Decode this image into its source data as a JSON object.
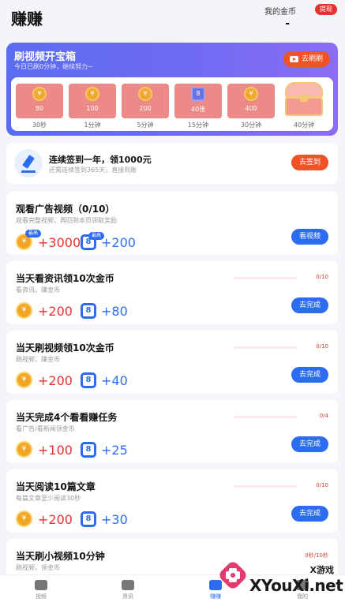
{
  "header": {
    "title": "赚赚",
    "gold_label": "我的金币",
    "withdraw_label": "提现",
    "gold_value": "-"
  },
  "treasure": {
    "title": "刷视频开宝箱",
    "subtitle": "今日已刷0分钟，继续努力~",
    "button_label": "去刷刷",
    "slots": [
      {
        "value": "80",
        "time": "30秒",
        "icon": "coin-icon"
      },
      {
        "value": "100",
        "time": "1分钟",
        "icon": "coin-icon"
      },
      {
        "value": "200",
        "time": "5分钟",
        "icon": "coin-icon"
      },
      {
        "value": "40张",
        "time": "15分钟",
        "icon": "coupon-icon"
      },
      {
        "value": "400",
        "time": "30分钟",
        "icon": "coin-icon"
      },
      {
        "value": "",
        "time": "40分钟",
        "icon": "treasure-chest-icon"
      }
    ]
  },
  "sign": {
    "title": "连续签到一年，领1000元",
    "subtitle": "还需连续签到365天，直接到账",
    "button_label": "去签到"
  },
  "tasks": [
    {
      "title": "观看广告视频（0/10）",
      "subtitle": "观看完整视频，再回到本页领取奖励",
      "coin_reward": "+3000",
      "rmb_reward": "+200",
      "coin_tag": "最高",
      "rmb_tag": "最高",
      "button_label": "看视频",
      "progress": ""
    },
    {
      "title": "当天看资讯领10次金币",
      "subtitle": "看资讯，赚金币",
      "coin_reward": "+200",
      "rmb_reward": "+80",
      "button_label": "去完成",
      "progress": "0/10"
    },
    {
      "title": "当天刷视频领10次金币",
      "subtitle": "刷视频，赚金币",
      "coin_reward": "+200",
      "rmb_reward": "+40",
      "button_label": "去完成",
      "progress": "0/10"
    },
    {
      "title": "当天完成4个看看赚任务",
      "subtitle": "看广告/看新闻领金币",
      "coin_reward": "+100",
      "rmb_reward": "+25",
      "button_label": "去完成",
      "progress": "0/4"
    },
    {
      "title": "当天阅读10篇文章",
      "subtitle": "每篇文章至少阅读30秒",
      "coin_reward": "+200",
      "rmb_reward": "+30",
      "button_label": "去完成",
      "progress": "0/10"
    },
    {
      "title": "当天刷小视频10分钟",
      "subtitle": "刷视频，领金币",
      "progress": "0秒/10秒"
    }
  ],
  "bottom_nav": [
    {
      "label": "视频",
      "icon": "video-icon"
    },
    {
      "label": "资讯",
      "icon": "news-icon"
    },
    {
      "label": "赚赚",
      "icon": "earn-icon"
    },
    {
      "label": "我的",
      "icon": "profile-icon"
    }
  ],
  "watermark": {
    "brand_cn": "X游戏",
    "brand_en": "XYouXi.net"
  },
  "colors": {
    "accent_blue": "#2c6cf0",
    "accent_red": "#e8322f",
    "cta_orange": "#f05326",
    "treasure_gradient": "#5b6cf0"
  }
}
